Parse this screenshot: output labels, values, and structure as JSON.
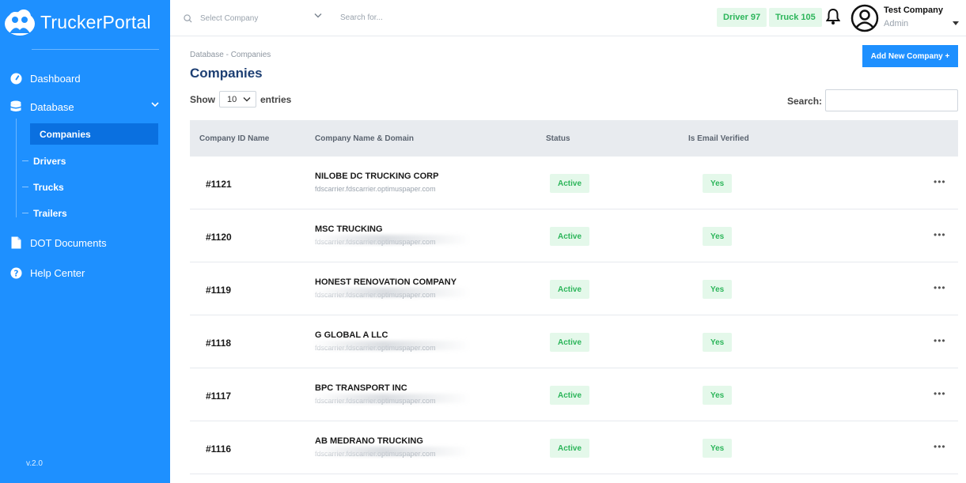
{
  "app": {
    "brand": "TruckerPortal",
    "version": "v.2.0"
  },
  "sidebar": {
    "items": [
      {
        "label": "Dashboard",
        "icon": "gauge-icon"
      },
      {
        "label": "Database",
        "icon": "database-icon"
      },
      {
        "label": "DOT Documents",
        "icon": "document-icon"
      },
      {
        "label": "Help Center",
        "icon": "help-icon"
      }
    ],
    "database_sub": [
      {
        "label": "Companies",
        "active": true
      },
      {
        "label": "Drivers",
        "active": false
      },
      {
        "label": "Trucks",
        "active": false
      },
      {
        "label": "Trailers",
        "active": false
      }
    ]
  },
  "topbar": {
    "company_placeholder": "Select Company",
    "search_placeholder": "Search for...",
    "chips": [
      "Driver 97",
      "Truck 105"
    ],
    "user_name": "Test Company",
    "user_role": "Admin"
  },
  "page": {
    "breadcrumb": "Database - Companies",
    "title": "Companies",
    "add_button": "Add New Company +",
    "show_label": "Show",
    "entries_value": "10",
    "entries_label": "entries",
    "search_label": "Search:"
  },
  "table": {
    "headers": [
      "Company ID Name",
      "Company Name & Domain",
      "Status",
      "Is Email Verified"
    ],
    "rows": [
      {
        "id": "#1121",
        "name": "NILOBE DC TRUCKING CORP",
        "domain": "fdscarrier.fdscarrier.optimuspaper.com",
        "status": "Active",
        "verified": "Yes"
      },
      {
        "id": "#1120",
        "name": "MSC TRUCKING",
        "domain": "fdscarrier.fdscarrier.optimuspaper.com",
        "status": "Active",
        "verified": "Yes"
      },
      {
        "id": "#1119",
        "name": "HONEST RENOVATION COMPANY",
        "domain": "fdscarrier.fdscarrier.optimuspaper.com",
        "status": "Active",
        "verified": "Yes"
      },
      {
        "id": "#1118",
        "name": "G GLOBAL A LLC",
        "domain": "fdscarrier.fdscarrier.optimuspaper.com",
        "status": "Active",
        "verified": "Yes"
      },
      {
        "id": "#1117",
        "name": "BPC TRANSPORT INC",
        "domain": "fdscarrier.fdscarrier.optimuspaper.com",
        "status": "Active",
        "verified": "Yes"
      },
      {
        "id": "#1116",
        "name": "AB MEDRANO TRUCKING",
        "domain": "fdscarrier.fdscarrier.optimuspaper.com",
        "status": "Active",
        "verified": "Yes"
      }
    ]
  },
  "colors": {
    "sidebar": "#1e90ff",
    "active_item": "#0a70e0",
    "title": "#1d3f73",
    "badge_bg": "#e4f8ea",
    "badge_text": "#2cb55a"
  }
}
